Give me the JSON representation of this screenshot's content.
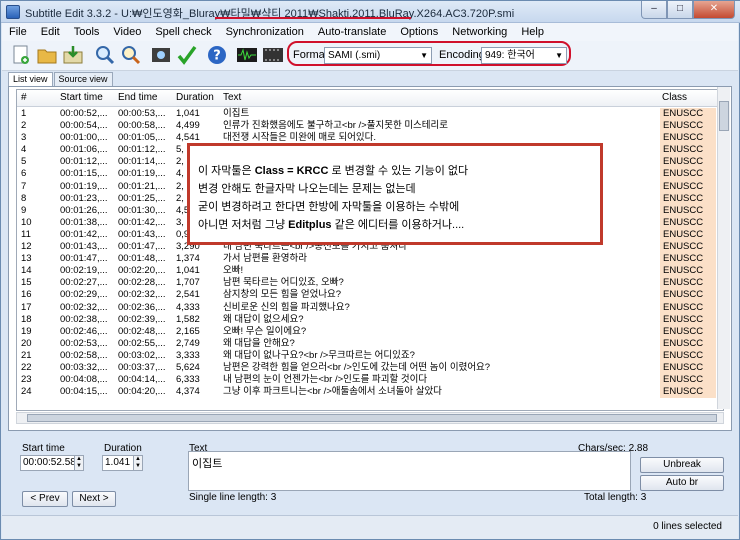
{
  "window": {
    "title": "Subtitle Edit 3.3.2 - U:₩인도영화_Bluray₩타밀₩샥티 2011₩Shakti.2011.BluRay.X264.AC3.720P.smi",
    "min_label": "–",
    "max_label": "□",
    "close_label": "✕"
  },
  "menu": [
    "File",
    "Edit",
    "Tools",
    "Video",
    "Spell check",
    "Synchronization",
    "Auto-translate",
    "Options",
    "Networking",
    "Help"
  ],
  "toolbar": {
    "icons": [
      "new-file-icon",
      "open-folder-icon",
      "save-icon",
      "find-icon",
      "replace-icon",
      "visual-sync-icon",
      "spell-check-icon",
      "help-icon",
      "waveform-icon",
      "video-icon"
    ],
    "format_label": "Format",
    "format_value": "SAMI (.smi)",
    "encoding_label": "Encoding",
    "encoding_value": "949: 한국어"
  },
  "tabs": [
    "List view",
    "Source view"
  ],
  "list": {
    "columns": [
      "#",
      "Start time",
      "End time",
      "Duration",
      "Text",
      "Class"
    ],
    "rows": [
      [
        "1",
        "00:00:52,...",
        "00:00:53,...",
        "1,041",
        "이집트",
        "ENUSCC"
      ],
      [
        "2",
        "00:00:54,...",
        "00:00:58,...",
        "4,499",
        "인류가 진화했음에도 불구하고<br />풀지못한 미스테리로",
        "ENUSCC"
      ],
      [
        "3",
        "00:01:00,...",
        "00:01:05,...",
        "4,541",
        "대전쟁 시작들은 미완에 매로 되어있다.",
        "ENUSCC"
      ],
      [
        "4",
        "00:01:06,...",
        "00:01:12,...",
        "5,",
        "",
        "ENUSCC"
      ],
      [
        "5",
        "00:01:12,...",
        "00:01:14,...",
        "2,",
        "",
        "ENUSCC"
      ],
      [
        "6",
        "00:01:15,...",
        "00:01:19,...",
        "4,",
        "",
        "ENUSCC"
      ],
      [
        "7",
        "00:01:19,...",
        "00:01:21,...",
        "2,",
        "",
        "ENUSCC"
      ],
      [
        "8",
        "00:01:23,...",
        "00:01:25,...",
        "2,",
        "",
        "ENUSCC"
      ],
      [
        "9",
        "00:01:26,...",
        "00:01:30,...",
        "4,5",
        "",
        "ENUSCC"
      ],
      [
        "10",
        "00:01:38,...",
        "00:01:42,...",
        "3,",
        "",
        "ENUSCC"
      ],
      [
        "11",
        "00:01:42,...",
        "00:01:43,...",
        "0,9",
        "",
        "ENUSCC"
      ],
      [
        "12",
        "00:01:43,...",
        "00:01:47,...",
        "3,290",
        "내 남편 묵타르는<br />송전보를 가지고 훔쳐다",
        "ENUSCC"
      ],
      [
        "13",
        "00:01:47,...",
        "00:01:48,...",
        "1,374",
        "가서 남편를 환영하라",
        "ENUSCC"
      ],
      [
        "14",
        "00:02:19,...",
        "00:02:20,...",
        "1,041",
        "오빠!",
        "ENUSCC"
      ],
      [
        "15",
        "00:02:27,...",
        "00:02:28,...",
        "1,707",
        "남편 묵타르는 어디있죠, 오빠?",
        "ENUSCC"
      ],
      [
        "16",
        "00:02:29,...",
        "00:02:32,...",
        "2,541",
        "삼지창의 모든 힘을 얻었나요?",
        "ENUSCC"
      ],
      [
        "17",
        "00:02:32,...",
        "00:02:36,...",
        "4,333",
        "신비로운 신의 힘을 파괴했나요?",
        "ENUSCC"
      ],
      [
        "18",
        "00:02:38,...",
        "00:02:39,...",
        "1,582",
        "왜 대답이 없으세요?",
        "ENUSCC"
      ],
      [
        "19",
        "00:02:46,...",
        "00:02:48,...",
        "2,165",
        "오빠! 무슨 일이에요?",
        "ENUSCC"
      ],
      [
        "20",
        "00:02:53,...",
        "00:02:55,...",
        "2,749",
        "왜 대답을 안해요?",
        "ENUSCC"
      ],
      [
        "21",
        "00:02:58,...",
        "00:03:02,...",
        "3,333",
        "왜 대답이 없나구요?<br />무크따르는 어디있죠?",
        "ENUSCC"
      ],
      [
        "22",
        "00:03:32,...",
        "00:03:37,...",
        "5,624",
        "남편은 강력한 힘을 얻으러<br />인도에 갔는데 어떤 놈이 이렸어요?",
        "ENUSCC"
      ],
      [
        "23",
        "00:04:08,...",
        "00:04:14,...",
        "6,333",
        "내 남편의 눈이 언젠가는<br />인도를 파괴할 것이다",
        "ENUSCC"
      ],
      [
        "24",
        "00:04:15,...",
        "00:04:20,...",
        "4,374",
        "그냥 이후 파크트니는<br />애둘솜에서 소녀돌아 살았다",
        "ENUSCC"
      ]
    ]
  },
  "overlay": {
    "line1_pre": "이 자막툴은 ",
    "line1_bold": "Class = KRCC",
    "line1_post": " 로 변경할 수 있는 기능이 없다",
    "line2": "변경 안해도 한글자막 나오는데는 문제는 없는데",
    "line3": "굳이 변경하려고 한다면 한방에 자막툴을 이용하는 수밖에",
    "line4_pre": "아니면 저처럼 그냥 ",
    "line4_bold": "Editplus",
    "line4_post": " 같은 에디터를 이용하거나....",
    "border_color": "#c0392b"
  },
  "editor": {
    "start_label": "Start time",
    "start_value": "00:00:52.583",
    "duration_label": "Duration",
    "duration_value": "1.041",
    "text_label": "Text",
    "text_value": "이집트",
    "chars_sec": "Chars/sec: 2.88",
    "prev_label": "< Prev",
    "next_label": "Next >",
    "single_line": "Single line length: 3",
    "total_length": "Total length: 3",
    "unbreak_label": "Unbreak",
    "autobr_label": "Auto br"
  },
  "status": {
    "selected": "0 lines selected"
  },
  "colors": {
    "annotation_red": "#d0102b",
    "class_cell": "#fbe0c8"
  }
}
